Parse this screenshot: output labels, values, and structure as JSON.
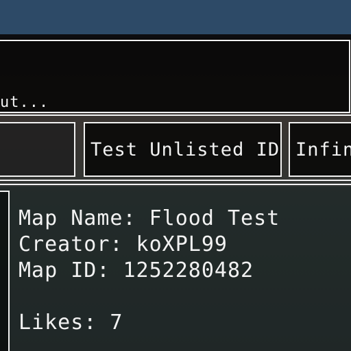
{
  "description": {
    "text": "ut..."
  },
  "tabs": {
    "prev_label": "",
    "current_label": "Test Unlisted ID",
    "next_label": "Infin"
  },
  "map_info": {
    "name_line": "Map Name: Flood Test",
    "creator_line": "Creator: koXPL99",
    "id_line": "Map ID: 1252280482",
    "likes_line": "Likes: 7"
  },
  "colors": {
    "top_strip": "#2d4a67",
    "border": "#f2f2f2",
    "text": "#f2f2f2"
  }
}
